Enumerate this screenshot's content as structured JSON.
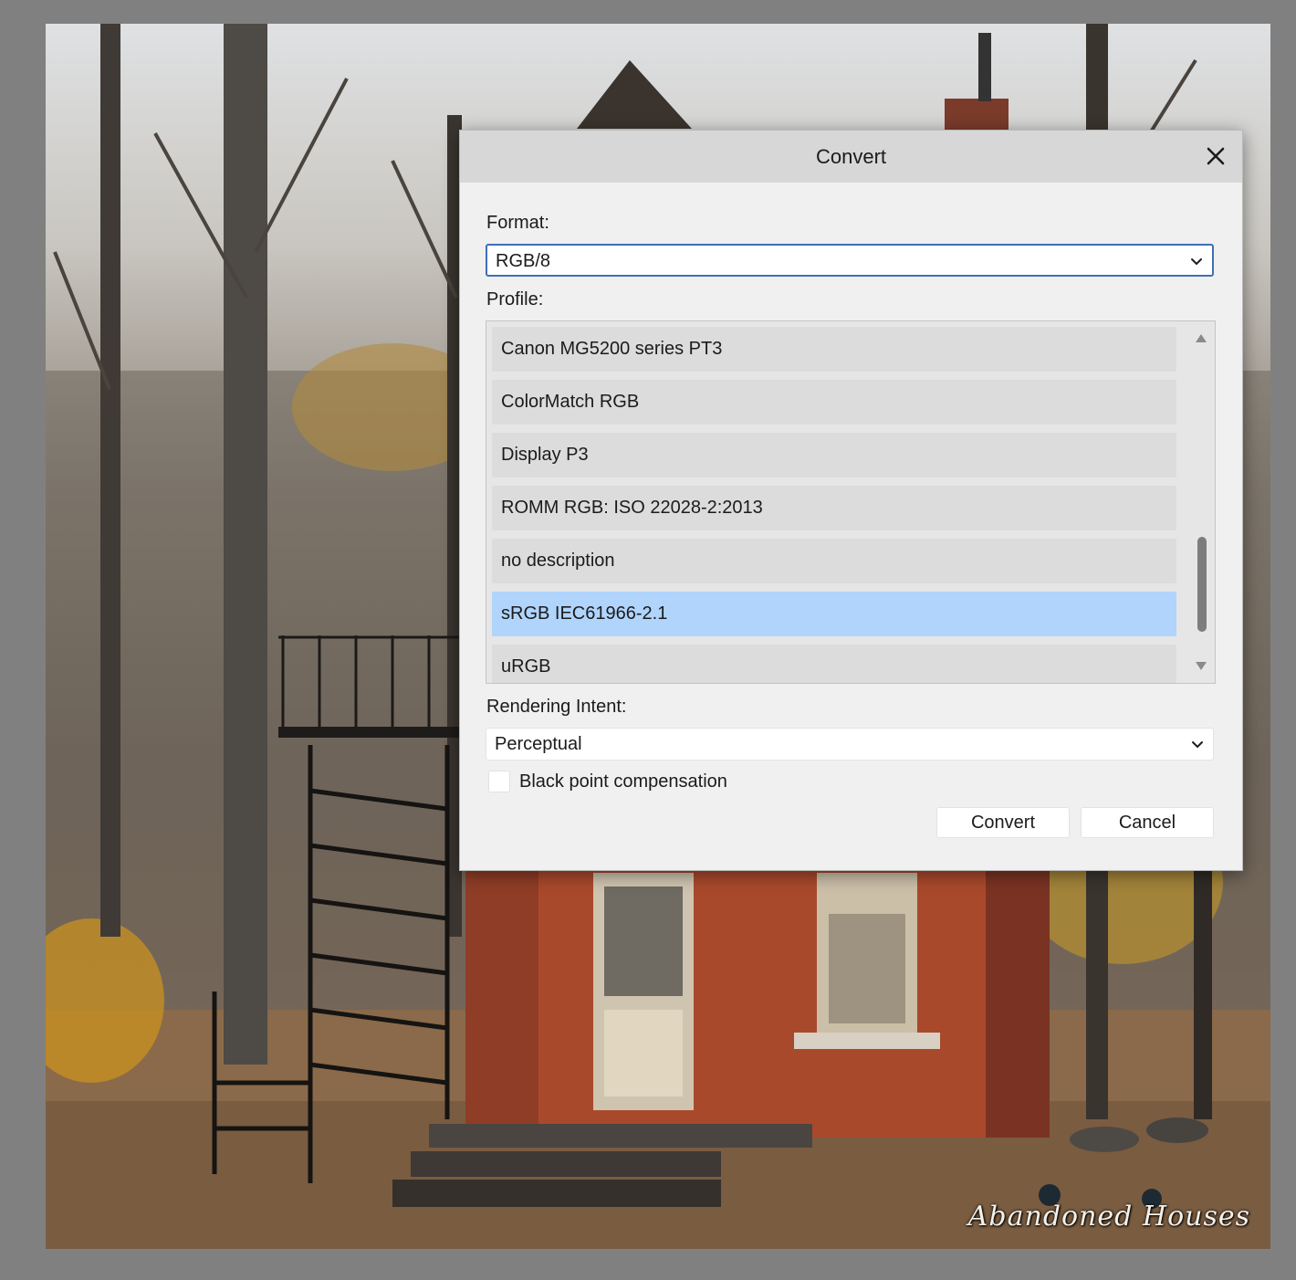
{
  "dialog": {
    "title": "Convert",
    "close_icon": "close-icon"
  },
  "format": {
    "label": "Format:",
    "value": "RGB/8"
  },
  "profile": {
    "label": "Profile:",
    "items": [
      {
        "label": "Canon MG5200 series PT3",
        "selected": false
      },
      {
        "label": "ColorMatch RGB",
        "selected": false
      },
      {
        "label": "Display P3",
        "selected": false
      },
      {
        "label": "ROMM RGB: ISO 22028-2:2013",
        "selected": false
      },
      {
        "label": "no description",
        "selected": false
      },
      {
        "label": "sRGB IEC61966-2.1",
        "selected": true
      },
      {
        "label": "uRGB",
        "selected": false
      }
    ],
    "scroll_fraction": 0.92
  },
  "rendering_intent": {
    "label": "Rendering Intent:",
    "value": "Perceptual"
  },
  "black_point_compensation": {
    "label": "Black point compensation",
    "checked": false
  },
  "buttons": {
    "convert": "Convert",
    "cancel": "Cancel"
  },
  "photo": {
    "watermark": "Abandoned Houses"
  },
  "colors": {
    "selected_item": "#b0d4fc",
    "focus_border": "#3f6fb5",
    "dialog_bg": "#f0f0f0",
    "titlebar_bg": "#d7d7d7"
  }
}
